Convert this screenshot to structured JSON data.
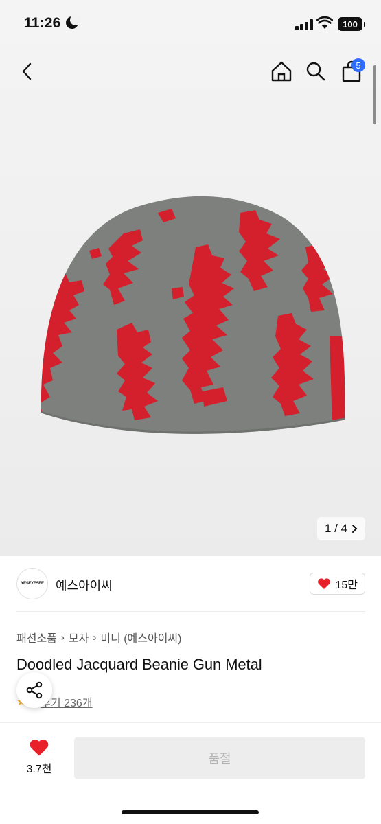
{
  "status_bar": {
    "time": "11:26",
    "battery": "100"
  },
  "nav": {
    "cart_count": "5"
  },
  "gallery": {
    "counter": "1 / 4"
  },
  "brand": {
    "logo_text": "YESEYESEE",
    "name": "예스아이씨",
    "likes": "15만"
  },
  "breadcrumb": [
    "패션소품",
    "모자",
    "비니 (예스아이씨)"
  ],
  "product": {
    "title": "Doodled Jacquard Beanie Gun Metal",
    "rating": "5",
    "reviews": "후기 236개"
  },
  "bottom": {
    "wish_count": "3.7천",
    "buy_label": "품절"
  },
  "colors": {
    "accent": "#2f6bff",
    "heart": "#e8202a",
    "beanie_gray": "#7d807d",
    "beanie_red": "#d41f2c"
  }
}
